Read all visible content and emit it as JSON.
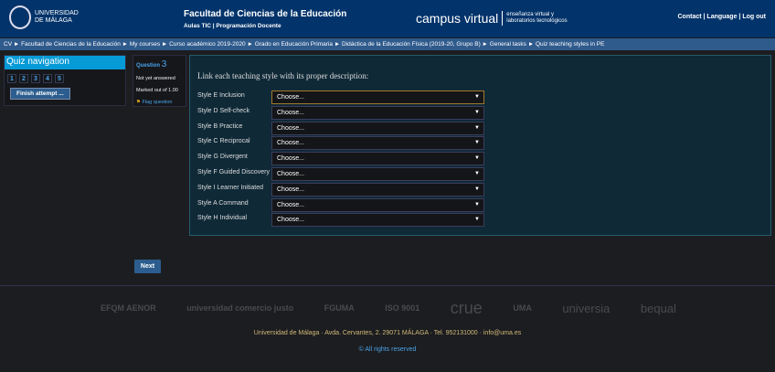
{
  "header": {
    "logo_lines": [
      "UNIVERSIDAD",
      "DE MÁLAGA"
    ],
    "faculty": "Facultad de Ciencias de la Educación",
    "sublinks": "Aulas TIC | Programación Docente",
    "campus": "campus virtual",
    "campus_sub": [
      "enseñanza virtual y",
      "laboratorios tecnológicos"
    ],
    "links": [
      "Contact",
      "Language",
      "Log out"
    ]
  },
  "breadcrumb": [
    "CV",
    "Facultad de Ciencias de la Educación",
    "My courses",
    "Curso académico 2019-2020",
    "Grado en Educación Primaria",
    "Didáctica de la Educación Física (2019-20, Grupo B)",
    "General tasks",
    "Quiz teaching styles in PE"
  ],
  "quiz_nav": {
    "title": "Quiz navigation",
    "numbers": [
      "1",
      "2",
      "3",
      "4",
      "5"
    ],
    "finish": "Finish attempt ..."
  },
  "question": {
    "label": "Question",
    "number": "3",
    "status": "Not yet answered",
    "marked": "Marked out of 1.00",
    "flag": "Flag question"
  },
  "main": {
    "prompt": "Link each teaching style with its proper description:",
    "placeholder": "Choose...",
    "rows": [
      "Style E Inclusion",
      "Style D Self-check",
      "Style B Practice",
      "Style C Reciprocal",
      "Style G Divergent",
      "Style F Guided Discovery",
      "Style I Learner Initiated",
      "Style A Command",
      "Style H Individual"
    ]
  },
  "next": "Next",
  "footer": {
    "logos": [
      "EFQM AENOR",
      "universidad comercio justo",
      "FGUMA",
      "ISO 9001",
      "crue",
      "UMA",
      "universia",
      "bequal"
    ],
    "address": "Universidad de Málaga · Avda. Cervantes, 2. 29071 MÁLAGA · Tel. 952131000 · info@uma.es",
    "rights": "© All rights reserved"
  }
}
